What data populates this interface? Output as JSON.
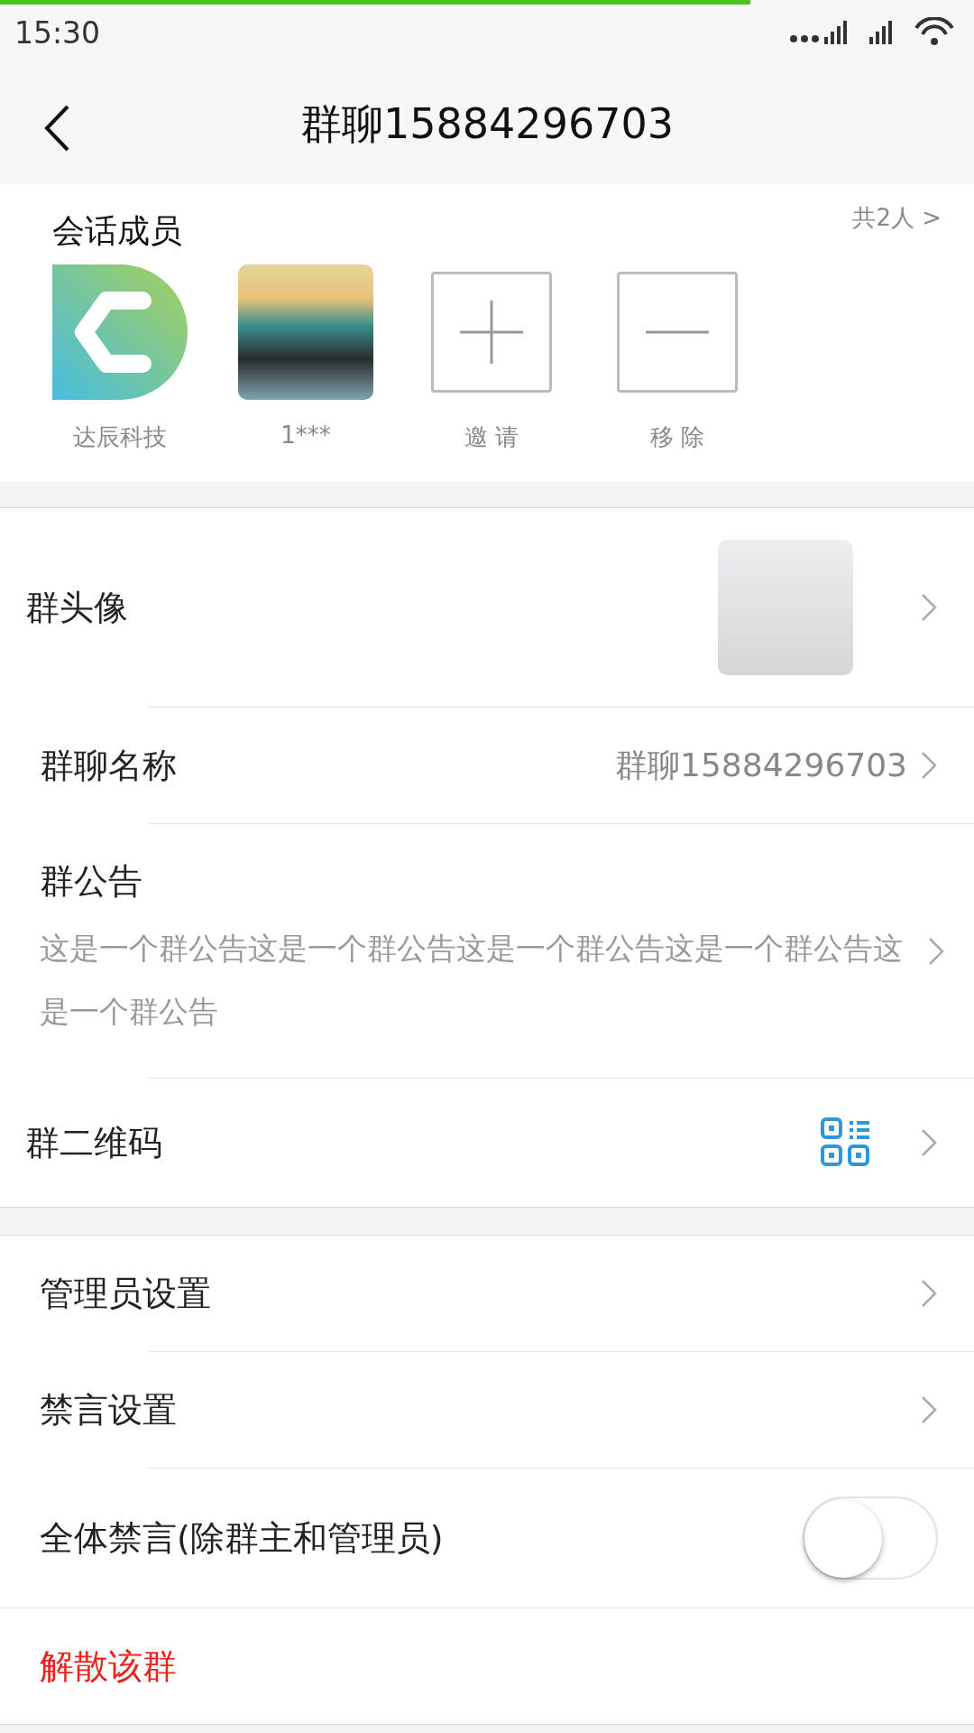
{
  "status_bar": {
    "time": "15:30",
    "load_progress": {
      "level": 0.77
    }
  },
  "header": {
    "title": "群聊15884296703"
  },
  "members": {
    "title": "会话成员",
    "count_link": "共2人 >",
    "items": [
      {
        "kind": "logo",
        "name": "达辰科技"
      },
      {
        "kind": "photo",
        "name": "1***"
      },
      {
        "kind": "add",
        "name": "邀 请"
      },
      {
        "kind": "remove",
        "name": "移 除"
      }
    ]
  },
  "sections": [
    [
      {
        "kind": "avatar",
        "label": "群头像"
      },
      {
        "kind": "value",
        "label": "群聊名称",
        "value": "群聊15884296703"
      },
      {
        "kind": "notice",
        "label": "群公告",
        "value": "这是一个群公告这是一个群公告这是一个群公告这是一个群公告这是一个群公告"
      },
      {
        "kind": "qr",
        "label": "群二维码"
      }
    ],
    [
      {
        "kind": "plain",
        "label": "管理员设置"
      },
      {
        "kind": "plain",
        "label": "禁言设置"
      },
      {
        "kind": "toggle",
        "label": "全体禁言(除群主和管理员)",
        "on": false
      },
      {
        "kind": "danger",
        "label": "解散该群"
      }
    ]
  ]
}
